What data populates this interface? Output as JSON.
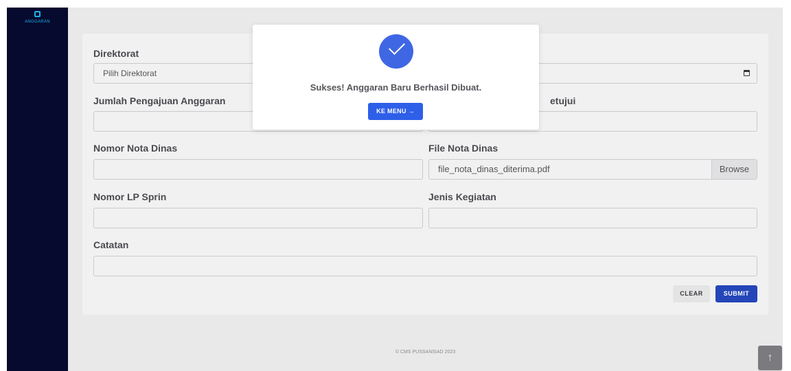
{
  "sidebar": {
    "brand": "ANGGARAN",
    "brand_icon": "wallet-icon"
  },
  "form": {
    "direktorat_label": "Direktorat",
    "direktorat_value": "Pilih Direktorat",
    "jumlah_label": "Jumlah Pengajuan Anggaran",
    "jumlah_value": "",
    "disetujui_label_fragment": "etujui",
    "nota_label": "Nomor Nota Dinas",
    "nota_value": "",
    "file_label": "File Nota Dinas",
    "file_value": "file_nota_dinas_diterima.pdf",
    "browse_label": "Browse",
    "lp_label": "Nomor LP Sprin",
    "lp_value": "",
    "jenis_label": "Jenis Kegiatan",
    "jenis_value": "",
    "catatan_label": "Catatan",
    "catatan_value": "",
    "clear_label": "CLEAR",
    "submit_label": "SUBMIT"
  },
  "modal": {
    "message": "Sukses! Anggaran Baru Berhasil Dibuat.",
    "button_label": "KE MENU →",
    "icon": "check-icon",
    "accent": "#3f67e4"
  },
  "footer": {
    "text": "© CMS PUSSANSIAD 2023"
  },
  "scroll_top_icon": "↑"
}
